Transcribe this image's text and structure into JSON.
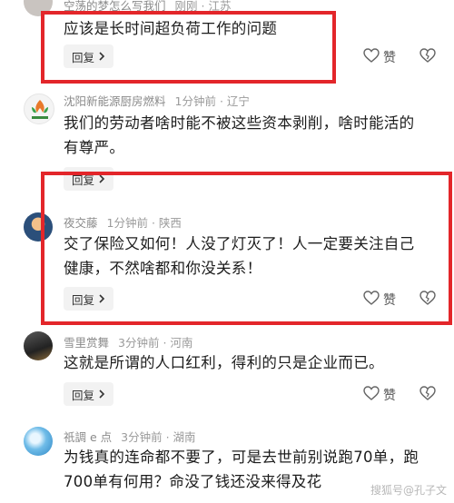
{
  "comments": [
    {
      "author": "空荡的梦怎么写我们",
      "time": "刚刚",
      "region": "江苏",
      "text": "应该是长时间超负荷工作的问题",
      "reply": "回复",
      "like": "赞"
    },
    {
      "author": "沈阳新能源厨房燃料",
      "time": "1分钟前",
      "region": "辽宁",
      "text": "我们的劳动者啥时能不被这些资本剥削，啥时能活的有尊严。",
      "reply": "回复",
      "like": "赞"
    },
    {
      "author": "夜交藤",
      "time": "1分钟前",
      "region": "陕西",
      "text": "交了保险又如何！人没了灯灭了！人一定要关注自己健康，不然啥都和你没关系！",
      "reply": "回复",
      "like": "赞"
    },
    {
      "author": "雪里赏舞",
      "time": "3分钟前",
      "region": "河南",
      "text": "这就是所谓的人口红利，得利的只是企业而已。",
      "reply": "回复",
      "like": "赞"
    },
    {
      "author": "祇調 e 点",
      "time": "3分钟前",
      "region": "湖南",
      "text": "为钱真的连命都不要了，可是去世前别说跑70单，跑700单有何用？命没了钱还没来得及花",
      "reply": "回复",
      "like": "赞"
    }
  ],
  "separator": "·",
  "watermark": "搜狐号@孔子文",
  "colors": {
    "highlight": "#e3262a",
    "reply_bg": "#f2f2f2",
    "meta": "#9a9a9a"
  },
  "icons": [
    "chevron-right-icon",
    "heart-icon",
    "broken-heart-icon"
  ]
}
